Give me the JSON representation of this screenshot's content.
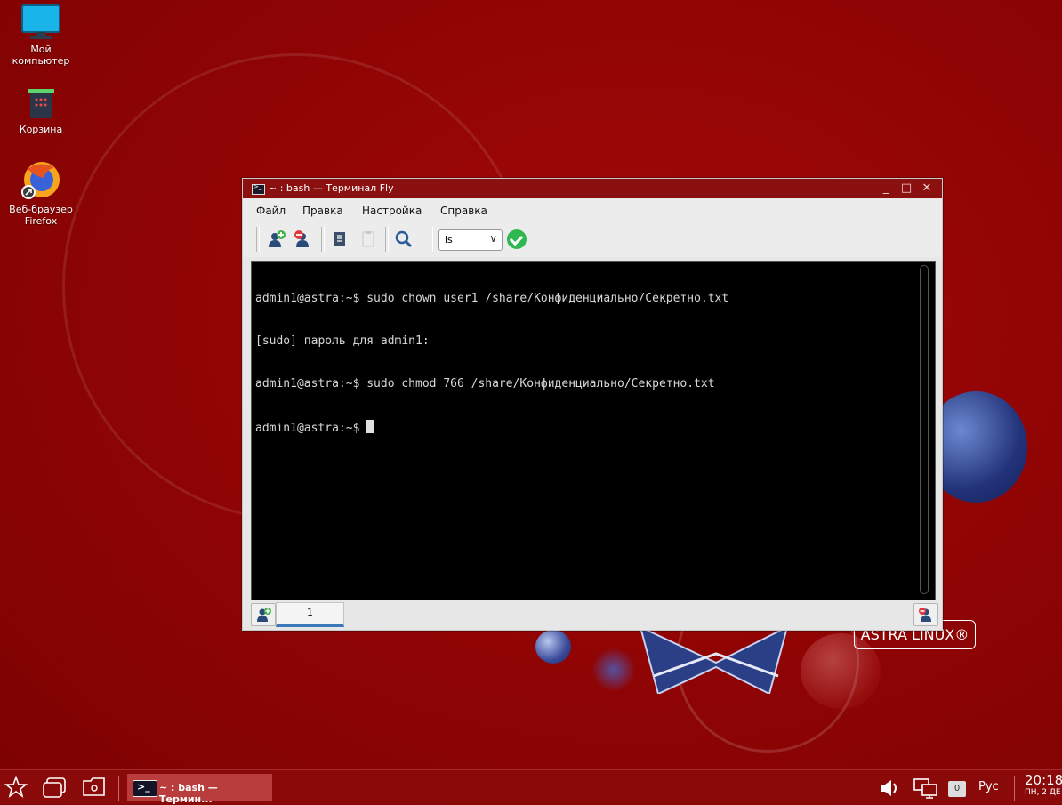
{
  "desktop": {
    "icons": [
      {
        "name": "my-computer",
        "label_line1": "Мой",
        "label_line2": "компьютер"
      },
      {
        "name": "trash",
        "label_line1": "Корзина",
        "label_line2": ""
      },
      {
        "name": "firefox",
        "label_line1": "Веб-браузер",
        "label_line2": "Firefox"
      }
    ],
    "brand_logo": "ASTRA LINUX®"
  },
  "window": {
    "title": "~ : bash — Терминал Fly",
    "menu": [
      "Файл",
      "Правка",
      "Настройка",
      "Справка"
    ],
    "toolbar": {
      "command_combo_value": "ls",
      "icons": [
        "new-session-icon",
        "close-session-icon",
        "copy-icon",
        "paste-icon",
        "search-icon",
        "run-icon"
      ]
    },
    "terminal": {
      "lines": [
        "admin1@astra:~$ sudo chown user1 /share/Конфиденциально/Секретно.txt",
        "[sudo] пароль для admin1:",
        "admin1@astra:~$ sudo chmod 766 /share/Конфиденциально/Секретно.txt",
        "admin1@astra:~$ "
      ]
    },
    "tabs": [
      {
        "label": "1"
      }
    ]
  },
  "taskbar": {
    "task_title": "~ : bash — Термин...",
    "notification_count": "0",
    "language": "Рус",
    "time": "20:18",
    "date": "ПН, 2 ДЕ"
  }
}
